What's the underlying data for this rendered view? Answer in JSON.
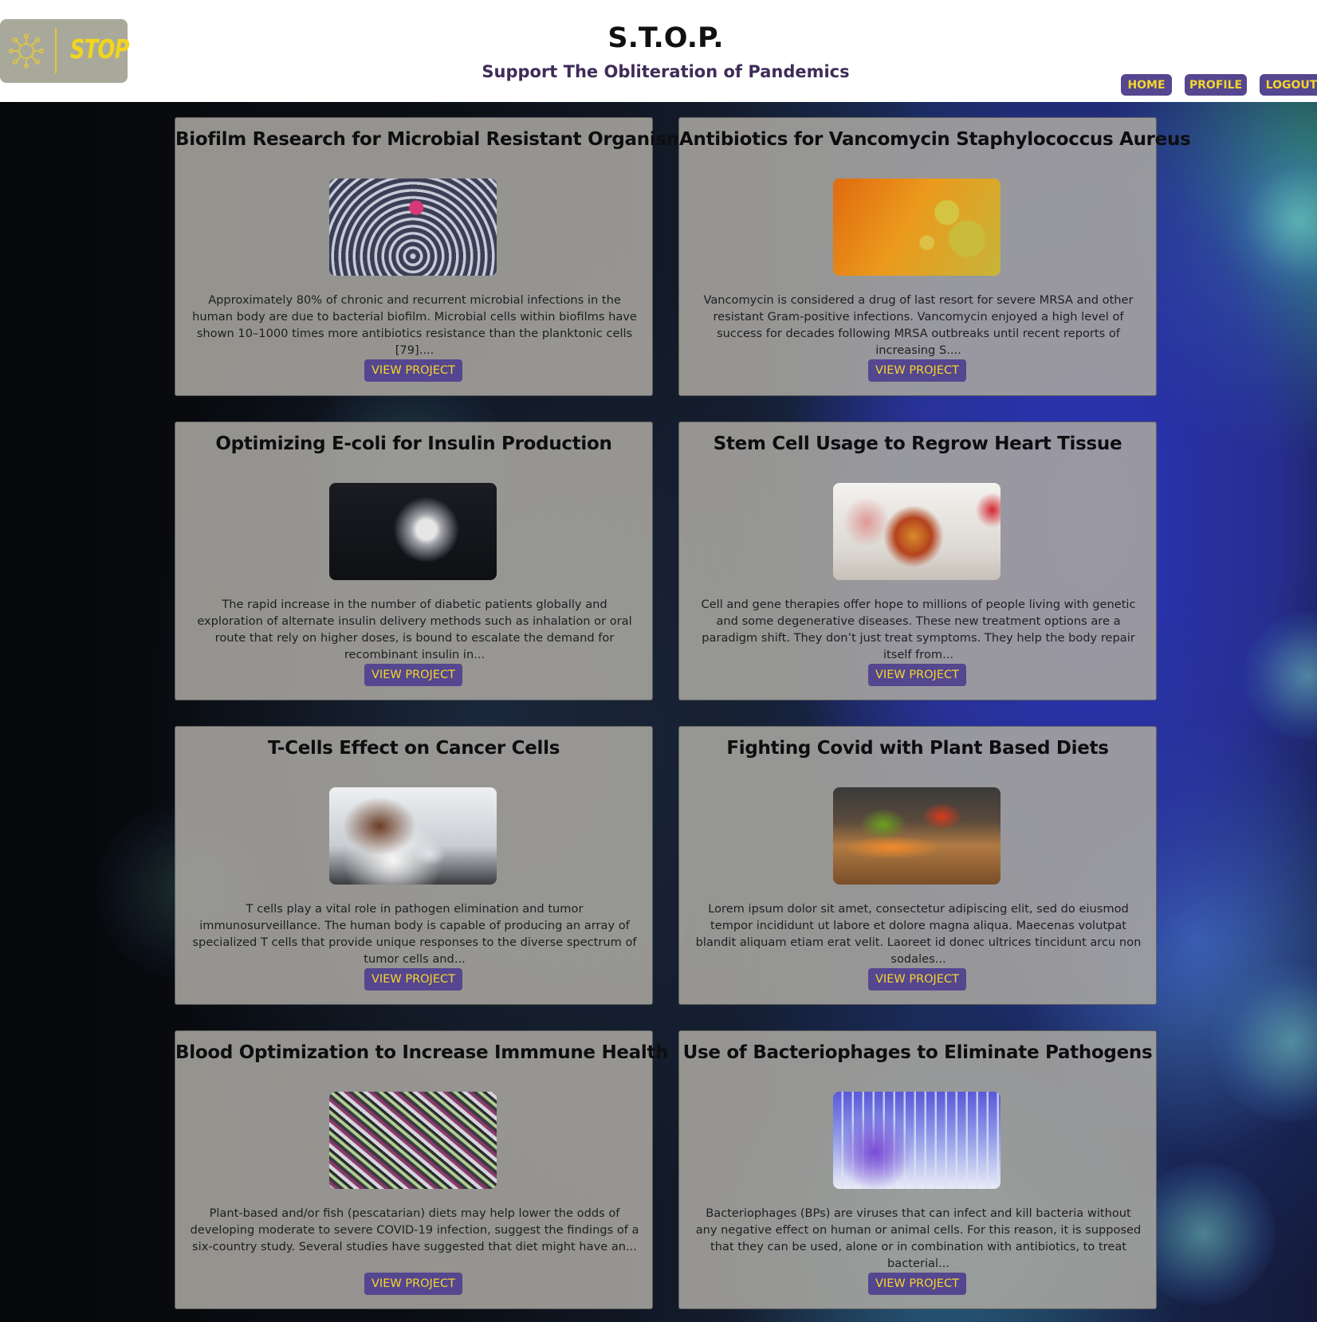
{
  "header": {
    "logo_text": "STOP",
    "title": "S.T.O.P.",
    "subtitle": "Support The Obliteration of Pandemics",
    "nav": {
      "home": "HOME",
      "profile": "PROFILE",
      "logout": "LOGOUT"
    }
  },
  "colors": {
    "accent": "#554690",
    "accent_text": "#f3d62b",
    "subtitle": "#3f2c59",
    "card_bg": "#a8a6a0"
  },
  "projects": [
    {
      "title": "Biofilm Research for Microbial Resistant Organisms",
      "image": "microplate-pipette-image",
      "description": "Approximately 80% of chronic and recurrent microbial infections in the human body are due to bacterial biofilm. Microbial cells within biofilms have shown 10–1000 times more antibiotics resistance than the planktonic cells [79]....",
      "button": "VIEW PROJECT"
    },
    {
      "title": "Antibiotics for Vancomycin Staphylococcus Aureus",
      "image": "oil-bubbles-image",
      "description": "Vancomycin is considered a drug of last resort for severe MRSA and other resistant Gram-positive infections. Vancomycin enjoyed a high level of success for decades following MRSA outbreaks until recent reports of increasing S....",
      "button": "VIEW PROJECT"
    },
    {
      "title": "Optimizing E-coli for Insulin Production",
      "image": "insulin-crystal-image",
      "description": "The rapid increase in the number of diabetic patients globally and exploration of alternate insulin delivery methods such as inhalation or oral route that rely on higher doses, is bound to escalate the demand for recombinant insulin in...",
      "button": "VIEW PROJECT"
    },
    {
      "title": "Stem Cell Usage to Regrow Heart Tissue",
      "image": "heart-model-image",
      "description": "Cell and gene therapies offer hope to millions of people living with genetic and some degenerative diseases. These new treatment options are a paradigm shift. They don’t just treat symptoms. They help the body repair itself from...",
      "button": "VIEW PROJECT"
    },
    {
      "title": "T-Cells Effect on Cancer Cells",
      "image": "lab-scientist-image",
      "description": "T cells play a vital role in pathogen elimination and tumor immunosurveillance. The human body is capable of producing an array of specialized T cells that provide unique responses to the diverse spectrum of tumor cells and...",
      "button": "VIEW PROJECT"
    },
    {
      "title": "Fighting Covid with Plant Based Diets",
      "image": "vegetables-board-image",
      "description": "Lorem ipsum dolor sit amet, consectetur adipiscing elit, sed do eiusmod tempor incididunt ut labore et dolore magna aliqua. Maecenas volutpat blandit aliquam etiam erat velit. Laoreet id donec ultrices tincidunt arcu non sodales...",
      "button": "VIEW PROJECT"
    },
    {
      "title": "Blood Optimization to Increase Immmune Health",
      "image": "blood-tubes-image",
      "description": "Plant-based and/or fish (pescatarian) diets may help lower the odds of developing moderate to severe COVID-19 infection, suggest the findings of a six-country study. Several studies have suggested that diet might have an...",
      "button": "VIEW PROJECT"
    },
    {
      "title": "Use of Bacteriophages to Eliminate Pathogens",
      "image": "bacteriophage-lab-image",
      "description": "Bacteriophages (BPs) are viruses that can infect and kill bacteria without any negative effect on human or animal cells. For this reason, it is supposed that they can be used, alone or in combination with antibiotics, to treat bacterial...",
      "button": "VIEW PROJECT"
    }
  ]
}
